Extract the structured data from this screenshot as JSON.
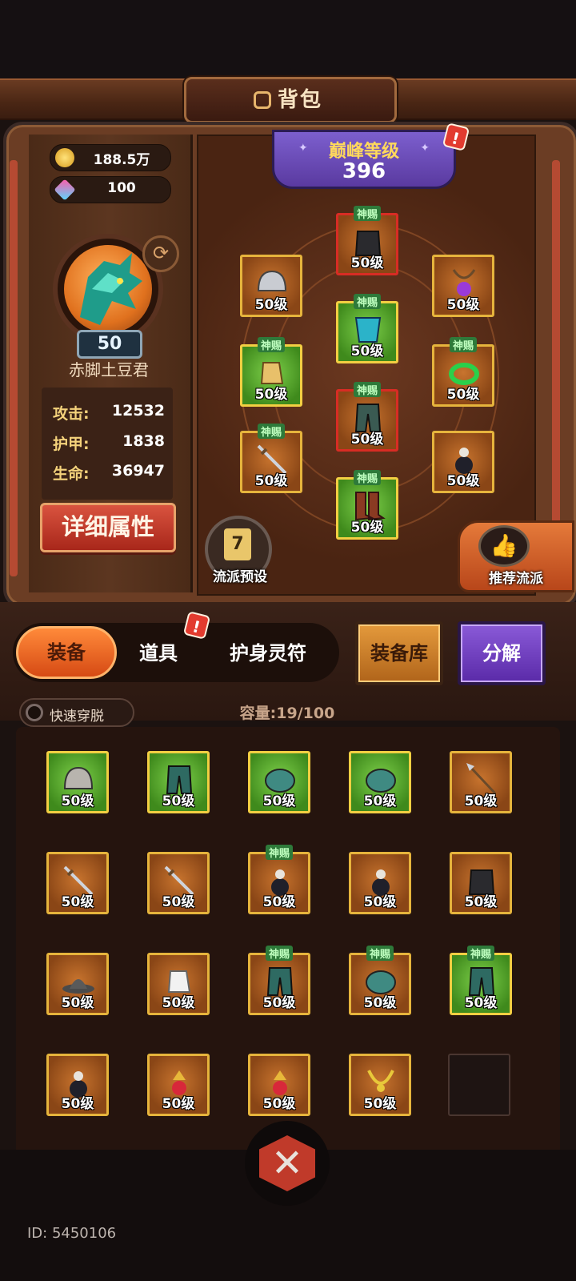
{
  "header": {
    "title": "背包"
  },
  "currency": {
    "gold": "188.5万",
    "gems": "100"
  },
  "player": {
    "level": "50",
    "name": "赤脚土豆君",
    "stats": [
      {
        "label": "攻击:",
        "value": "12532"
      },
      {
        "label": "护甲:",
        "value": "1838"
      },
      {
        "label": "生命:",
        "value": "36947"
      }
    ],
    "detail_button": "详细属性"
  },
  "peak": {
    "label": "巅峰等级",
    "value": "396"
  },
  "alert_mark": "!",
  "equipped": {
    "helmet": {
      "level": "50级",
      "tag": ""
    },
    "chest_top": {
      "level": "50级",
      "tag": "神赐"
    },
    "amulet": {
      "level": "50级",
      "tag": ""
    },
    "cape": {
      "level": "50级",
      "tag": "神赐"
    },
    "gloves": {
      "level": "50级",
      "tag": "神赐"
    },
    "ring": {
      "level": "50级",
      "tag": "神赐"
    },
    "weapon": {
      "level": "50级",
      "tag": "神赐"
    },
    "pants": {
      "level": "50级",
      "tag": "神赐"
    },
    "gourd": {
      "level": "50级",
      "tag": ""
    },
    "boots": {
      "level": "50级",
      "tag": "神赐"
    }
  },
  "preset": {
    "label": "流派预设",
    "icon_text": "7"
  },
  "recommend": {
    "label": "推荐流派"
  },
  "tabs": {
    "equipment": "装备",
    "items": "道具",
    "amulet": "护身灵符"
  },
  "buttons": {
    "library": "装备库",
    "decompose": "分解"
  },
  "quick_toggle": "快速穿脱",
  "capacity": "容量:19/100",
  "inventory": [
    {
      "level": "50级",
      "tag": "",
      "rarity": "green",
      "icon": "helmet-icon"
    },
    {
      "level": "50级",
      "tag": "",
      "rarity": "green",
      "icon": "pants-icon"
    },
    {
      "level": "50级",
      "tag": "",
      "rarity": "green",
      "icon": "shoulder-icon"
    },
    {
      "level": "50级",
      "tag": "",
      "rarity": "green",
      "icon": "shoulder-icon"
    },
    {
      "level": "50级",
      "tag": "",
      "rarity": "orange",
      "icon": "spear-icon"
    },
    {
      "level": "50级",
      "tag": "",
      "rarity": "orange",
      "icon": "sword-icon"
    },
    {
      "level": "50级",
      "tag": "",
      "rarity": "orange",
      "icon": "sword-icon"
    },
    {
      "level": "50级",
      "tag": "神赐",
      "rarity": "orange",
      "icon": "gourd-icon"
    },
    {
      "level": "50级",
      "tag": "",
      "rarity": "orange",
      "icon": "gourd-icon"
    },
    {
      "level": "50级",
      "tag": "",
      "rarity": "orange",
      "icon": "armor-icon"
    },
    {
      "level": "50级",
      "tag": "",
      "rarity": "orange",
      "icon": "hat-icon"
    },
    {
      "level": "50级",
      "tag": "",
      "rarity": "orange",
      "icon": "gloves-icon"
    },
    {
      "level": "50级",
      "tag": "神赐",
      "rarity": "orange",
      "icon": "pants-icon"
    },
    {
      "level": "50级",
      "tag": "神赐",
      "rarity": "orange",
      "icon": "shoulder-icon"
    },
    {
      "level": "50级",
      "tag": "神赐",
      "rarity": "green",
      "icon": "pants-icon"
    },
    {
      "level": "50级",
      "tag": "",
      "rarity": "orange",
      "icon": "gourd-icon"
    },
    {
      "level": "50级",
      "tag": "",
      "rarity": "orange",
      "icon": "charm-icon"
    },
    {
      "level": "50级",
      "tag": "",
      "rarity": "orange",
      "icon": "charm-icon"
    },
    {
      "level": "50级",
      "tag": "",
      "rarity": "orange",
      "icon": "necklace-icon"
    }
  ],
  "footer": {
    "uid": "ID: 5450106"
  },
  "colors": {
    "accent": "#d64a14",
    "gold_border": "#e6b43c",
    "green_rarity": "#3f8a1c",
    "red_border": "#d82c24",
    "purple": "#5a3aa0"
  }
}
